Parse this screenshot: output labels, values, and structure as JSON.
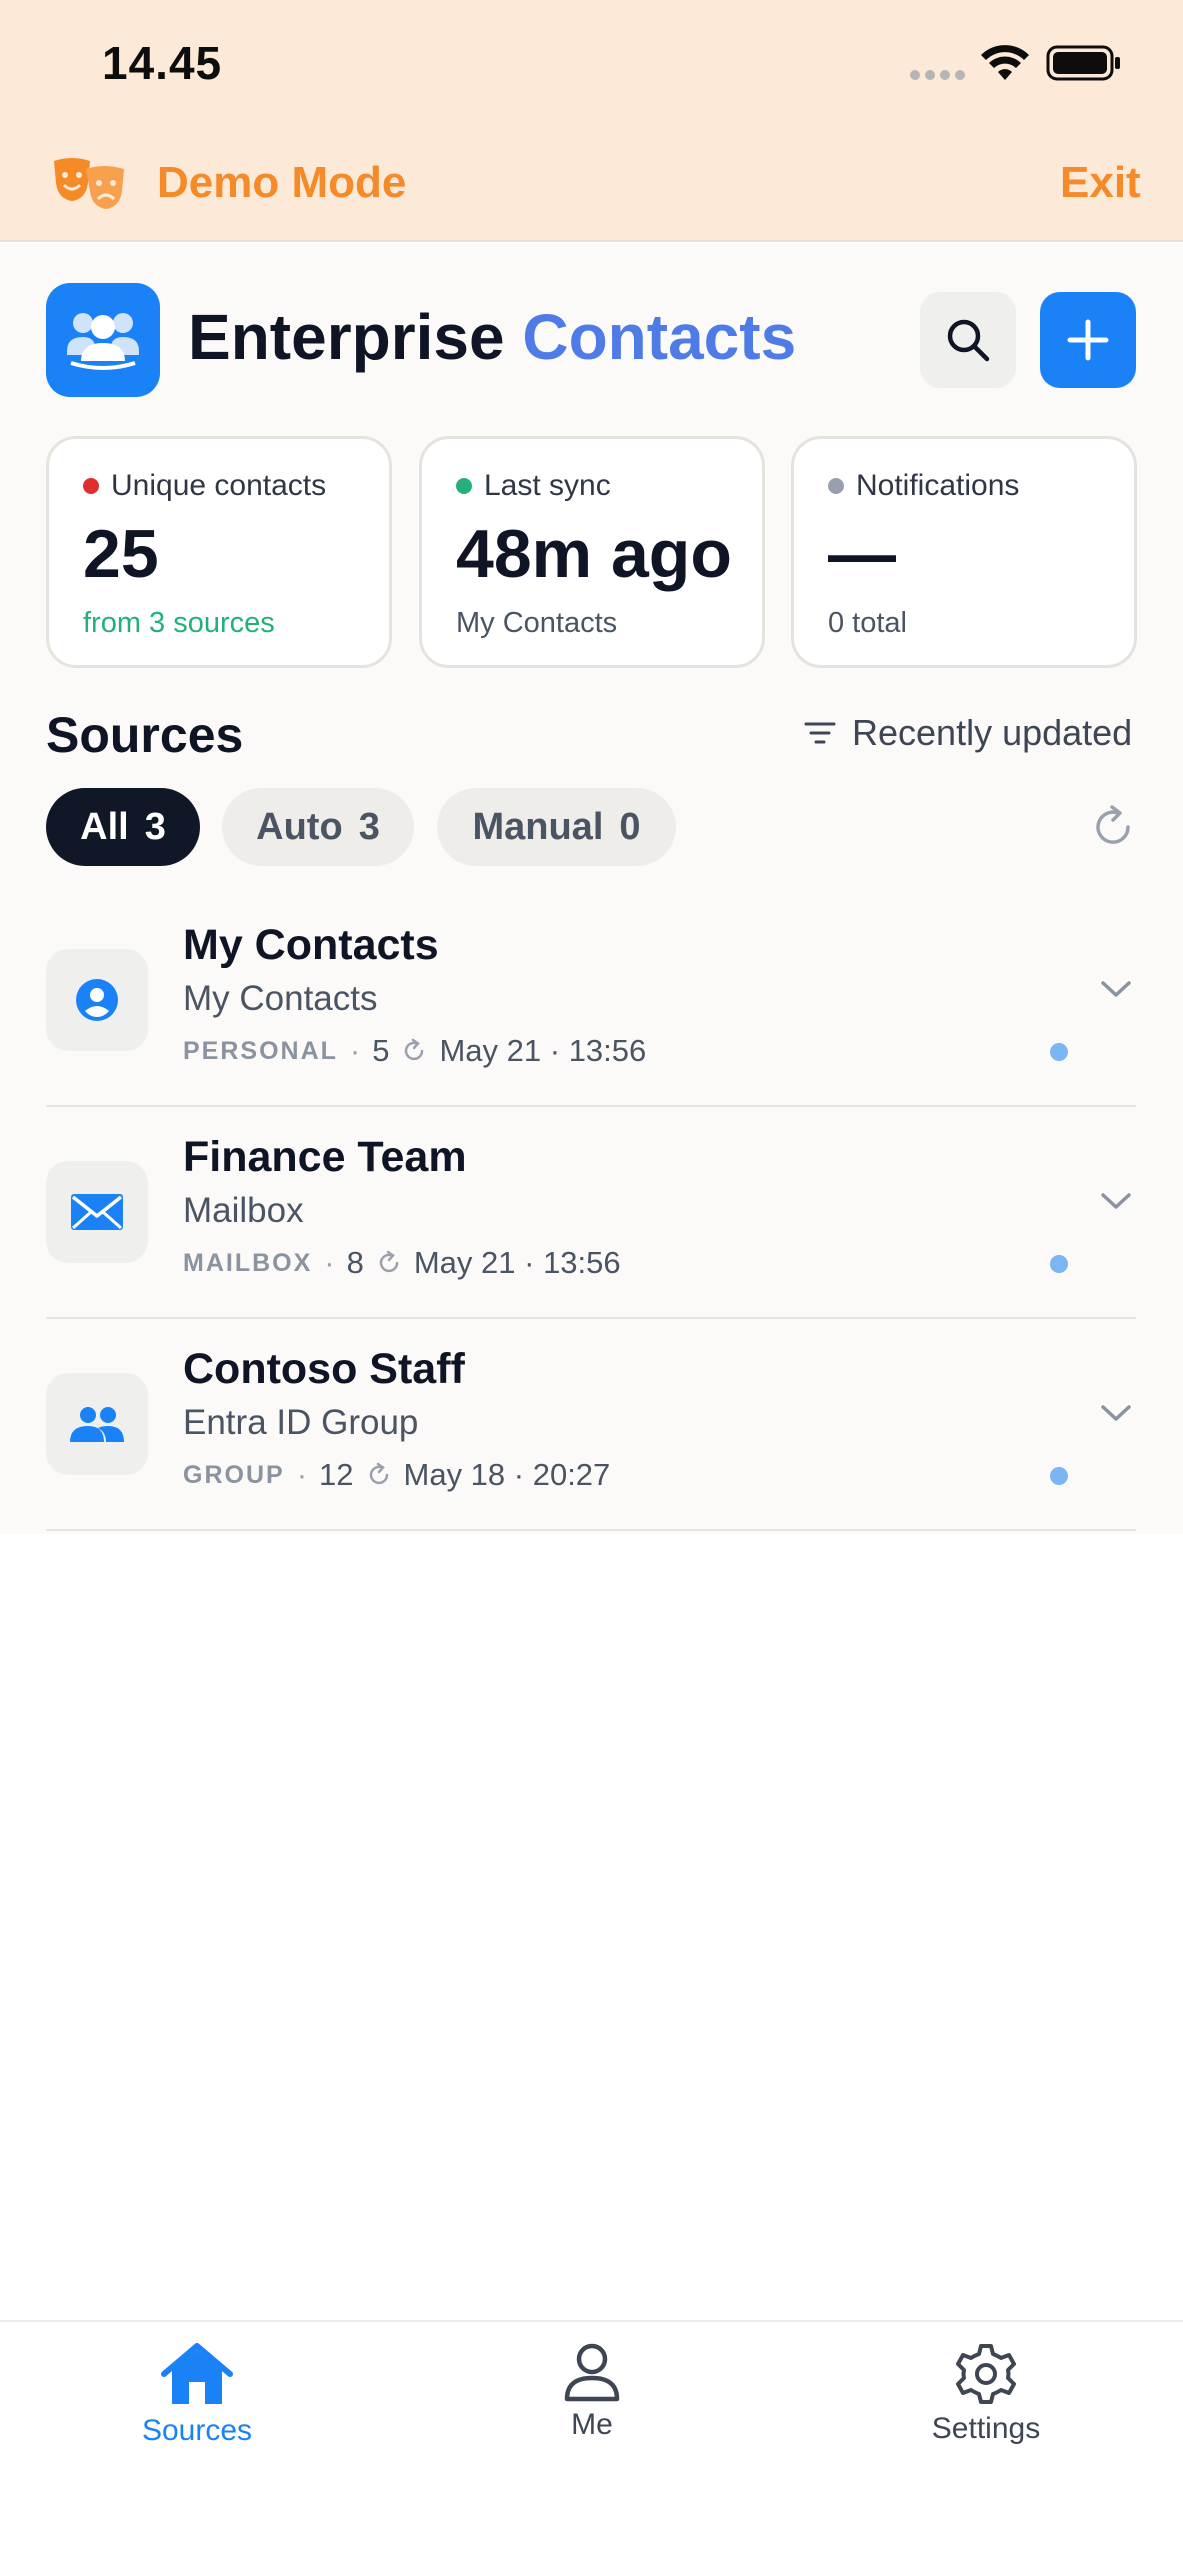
{
  "status_bar": {
    "time": "14.45"
  },
  "demo_banner": {
    "label": "Demo Mode",
    "exit_label": "Exit",
    "icon": "theater-masks-icon",
    "color": "#f48a28"
  },
  "header": {
    "title_primary": "Enterprise",
    "title_accent": "Contacts",
    "accent_color": "#4f7be6",
    "brand_color": "#1a82f6"
  },
  "stats": [
    {
      "label": "Unique contacts",
      "value": "25",
      "sub": "from 3 sources",
      "dot_color": "#e02e2e"
    },
    {
      "label": "Last sync",
      "value": "48m ago",
      "sub": "My Contacts",
      "dot_color": "#25b07a"
    },
    {
      "label": "Notifications",
      "value": "—",
      "sub": "0 total",
      "dot_color": "#98a0ad"
    }
  ],
  "sources_section": {
    "title": "Sources",
    "sort_label": "Recently updated"
  },
  "filters": [
    {
      "label": "All",
      "count": "3",
      "active": true
    },
    {
      "label": "Auto",
      "count": "3",
      "active": false
    },
    {
      "label": "Manual",
      "count": "0",
      "active": false
    }
  ],
  "sources": [
    {
      "name": "My Contacts",
      "type": "My Contacts",
      "kind": "PERSONAL",
      "sep1": "·",
      "count": "5",
      "date": "May 21 · 13:56",
      "icon": "person-circle-icon"
    },
    {
      "name": "Finance Team",
      "type": "Mailbox",
      "kind": "MAILBOX",
      "sep1": "·",
      "count": "8",
      "date": "May 21 · 13:56",
      "icon": "mail-icon"
    },
    {
      "name": "Contoso Staff",
      "type": "Entra ID Group",
      "kind": "GROUP",
      "sep1": "·",
      "count": "12",
      "date": "May 18 · 20:27",
      "icon": "people-icon"
    }
  ],
  "tabs": [
    {
      "label": "Sources",
      "icon": "home-icon",
      "active": true
    },
    {
      "label": "Me",
      "icon": "person-icon",
      "active": false
    },
    {
      "label": "Settings",
      "icon": "gear-icon",
      "active": false
    }
  ]
}
